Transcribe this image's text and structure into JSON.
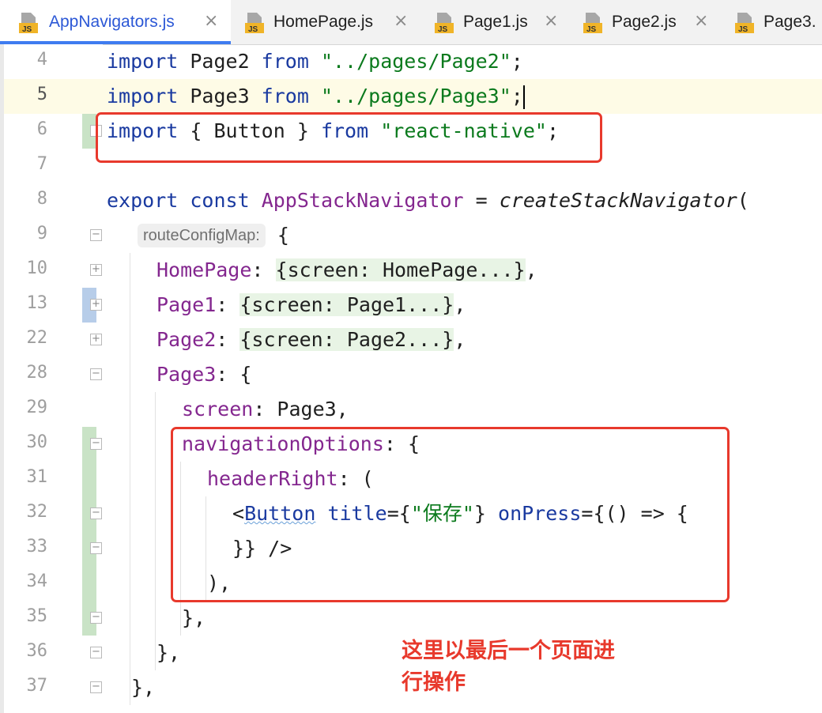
{
  "tabs": [
    {
      "icon": "js-file-icon",
      "title": "AppNavigators.js",
      "close": "×",
      "active": true
    },
    {
      "icon": "js-file-icon",
      "title": "HomePage.js",
      "close": "×",
      "active": false
    },
    {
      "icon": "js-file-icon",
      "title": "Page1.js",
      "close": "×",
      "active": false
    },
    {
      "icon": "js-file-icon",
      "title": "Page2.js",
      "close": "×",
      "active": false
    },
    {
      "icon": "js-file-icon",
      "title": "Page3.",
      "close": "",
      "active": false
    }
  ],
  "js_badge": "JS",
  "gutter": {
    "line_numbers": [
      "4",
      "5",
      "6",
      "7",
      "8",
      "9",
      "10",
      "13",
      "22",
      "28",
      "29",
      "30",
      "31",
      "32",
      "33",
      "34",
      "35",
      "36",
      "37"
    ],
    "current_line": "5"
  },
  "code": {
    "l4": {
      "t1": "import",
      "t2": " Page2 ",
      "t3": "from",
      "t4": " ",
      "t5": "\"../pages/Page2\"",
      "t6": ";"
    },
    "l5": {
      "t1": "import",
      "t2": " Page3 ",
      "t3": "from",
      "t4": " ",
      "t5": "\"../pages/Page3\"",
      "t6": ";"
    },
    "l6": {
      "t1": "import",
      "t2": " { Button } ",
      "t3": "from",
      "t4": " ",
      "t5": "\"react-native\"",
      "t6": ";"
    },
    "l8": {
      "t1": "export",
      "t2": " ",
      "t3": "const",
      "t4": " ",
      "t5": "AppStackNavigator",
      "t6": " = ",
      "t7": "createStackNavigator",
      "t8": "("
    },
    "l9": {
      "hint": "routeConfigMap:",
      "t1": " {"
    },
    "l10": {
      "p": "HomePage",
      "t1": ": ",
      "fold": "{screen: HomePage...}",
      "t2": ","
    },
    "l13": {
      "p": "Page1",
      "t1": ": ",
      "fold": "{screen: Page1...}",
      "t2": ","
    },
    "l22": {
      "p": "Page2",
      "t1": ": ",
      "fold": "{screen: Page2...}",
      "t2": ","
    },
    "l28": {
      "p": "Page3",
      "t1": ": {"
    },
    "l29": {
      "p": "screen",
      "t1": ": Page3,"
    },
    "l30": {
      "p": "navigationOptions",
      "t1": ": {"
    },
    "l31": {
      "p": "headerRight",
      "t1": ": ("
    },
    "l32": {
      "t1": "<",
      "tag": "Button",
      "t2": " ",
      "a1": "title",
      "t3": "={",
      "s1": "\"保存\"",
      "t4": "} ",
      "a2": "onPress",
      "t5": "={() => {"
    },
    "l33": {
      "t1": "}} />"
    },
    "l34": {
      "t1": "),"
    },
    "l35": {
      "t1": "},"
    },
    "l36": {
      "t1": "},"
    },
    "l37": {
      "t1": "},"
    }
  },
  "annotation": {
    "text": "这里以最后一个页面进\n行操作"
  },
  "colors": {
    "keyword": "#1a3aa0",
    "string": "#0b7a1d",
    "property": "#84278f",
    "annotation": "#e8392c",
    "active_tab_underline": "#3f7cf0"
  }
}
